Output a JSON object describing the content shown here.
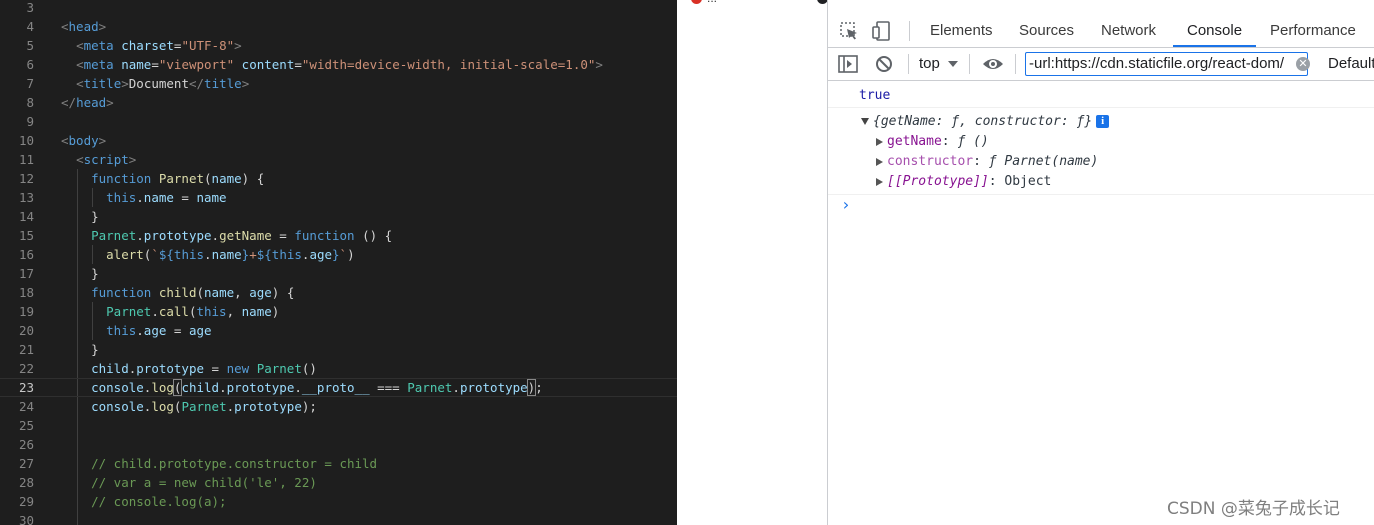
{
  "bookmarks": [
    {
      "label": "...",
      "color": "#d93025"
    },
    {
      "label": "...",
      "color": "#202124"
    },
    {
      "label": "...",
      "color": "#1a73e8"
    },
    {
      "label": "...",
      "color": "#a142f4"
    },
    {
      "label": "...",
      "color": "#34a853"
    }
  ],
  "editor": {
    "line_numbers": [
      "3",
      "4",
      "5",
      "6",
      "7",
      "8",
      "9",
      "10",
      "11",
      "12",
      "13",
      "14",
      "15",
      "16",
      "17",
      "18",
      "19",
      "20",
      "21",
      "22",
      "23",
      "24",
      "25",
      "26",
      "27",
      "28",
      "29",
      "30"
    ],
    "current_line": "23"
  },
  "devtools": {
    "tabs": [
      "Elements",
      "Sources",
      "Network",
      "Console",
      "Performance"
    ],
    "active_tab": "Console",
    "context": "top",
    "filter_value": "-url:https://cdn.staticfile.org/react-dom/",
    "levels_label": "Default",
    "console": {
      "line1": "true",
      "obj_summary": "{getName: ƒ, constructor: ƒ}",
      "info_badge": "i",
      "prop1_key": "getName",
      "prop1_value": "ƒ ()",
      "prop2_key": "constructor",
      "prop2_value": "ƒ Parnet(name)",
      "prop3_key": "[[Prototype]]",
      "prop3_value": "Object",
      "prompt": "›"
    }
  },
  "watermark": "CSDN @菜兔子成长记"
}
